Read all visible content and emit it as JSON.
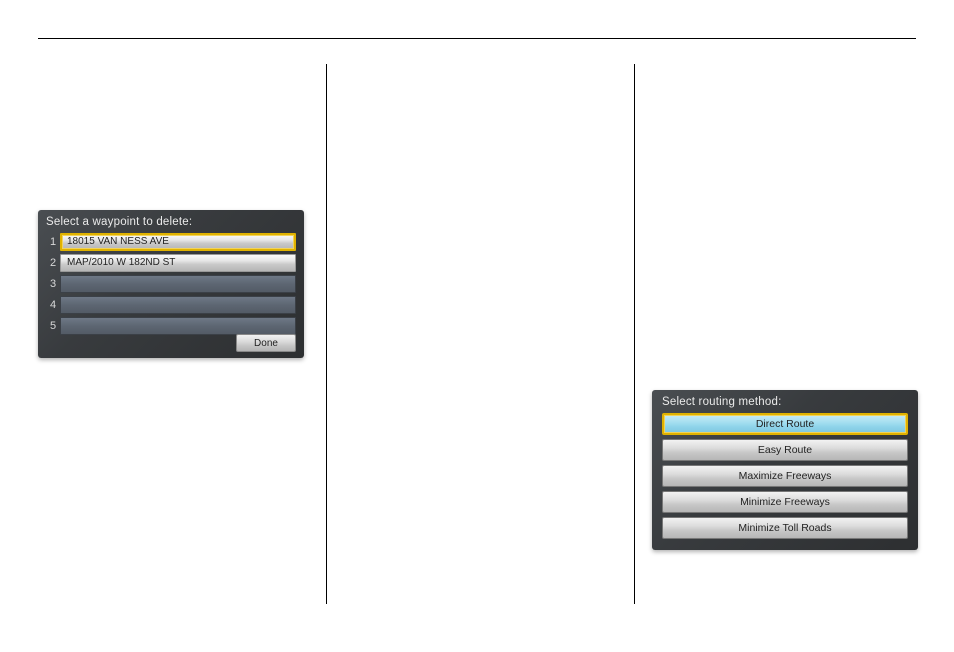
{
  "screen1": {
    "title": "Select a waypoint to delete:",
    "rows": [
      {
        "num": "1",
        "label": "18015 VAN NESS AVE"
      },
      {
        "num": "2",
        "label": "MAP/2010 W 182ND ST"
      },
      {
        "num": "3",
        "label": ""
      },
      {
        "num": "4",
        "label": ""
      },
      {
        "num": "5",
        "label": ""
      }
    ],
    "done_label": "Done"
  },
  "screen2": {
    "title": "Select routing method:",
    "options": [
      "Direct Route",
      "Easy Route",
      "Maximize Freeways",
      "Minimize Freeways",
      "Minimize Toll Roads"
    ]
  }
}
